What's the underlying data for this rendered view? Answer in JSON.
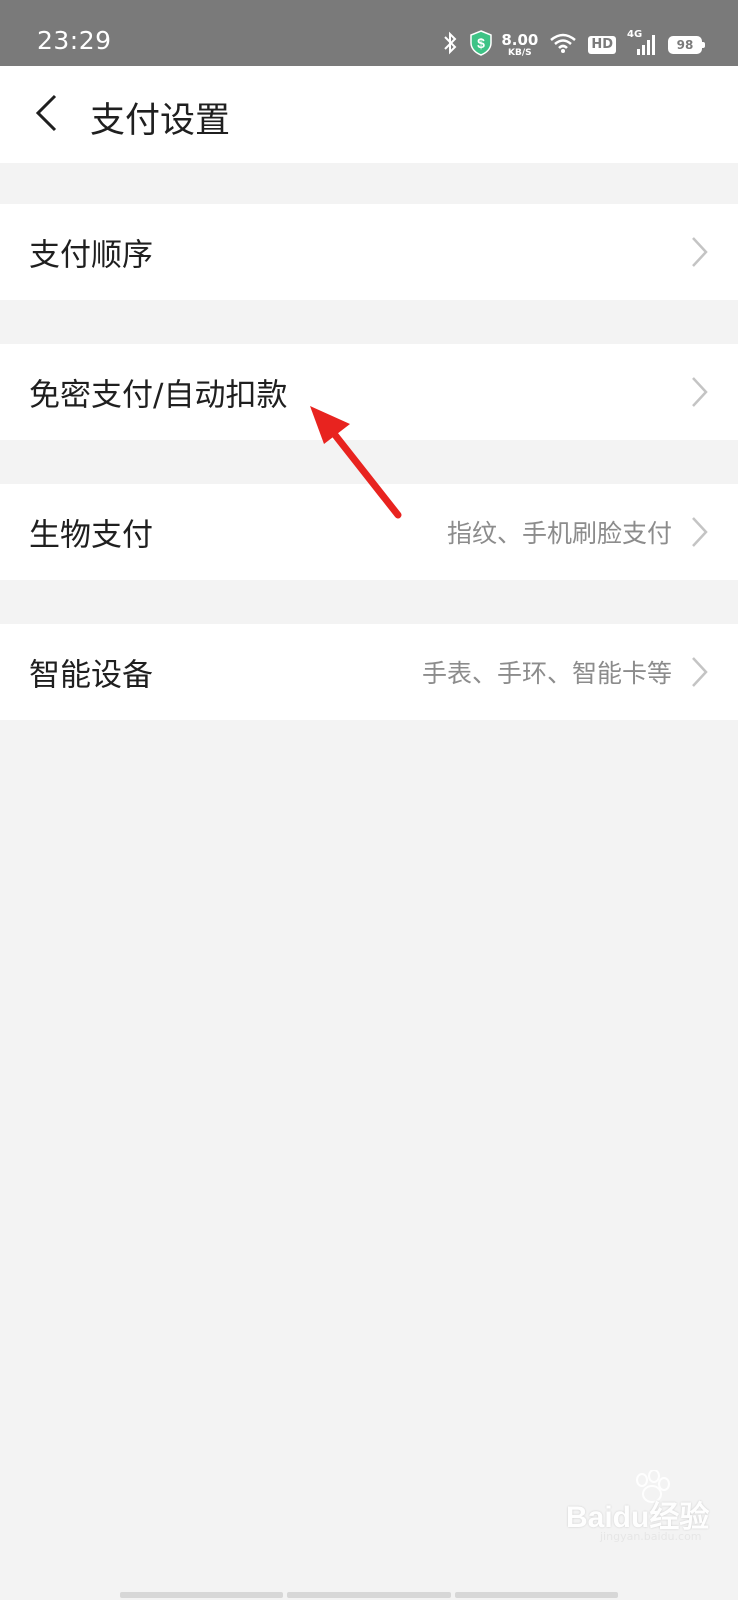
{
  "status_bar": {
    "time": "23:29",
    "network_speed_value": "8.00",
    "network_speed_unit": "KB/S",
    "hd_label": "HD",
    "signal_label": "4G",
    "battery_level": "98"
  },
  "nav": {
    "title": "支付设置"
  },
  "rows": [
    {
      "label": "支付顺序",
      "value": ""
    },
    {
      "label": "免密支付/自动扣款",
      "value": ""
    },
    {
      "label": "生物支付",
      "value": "指纹、手机刷脸支付"
    },
    {
      "label": "智能设备",
      "value": "手表、手环、智能卡等"
    }
  ],
  "watermark": {
    "logo": "Baidu经验",
    "sub": "jingyan.baidu.com"
  },
  "colors": {
    "status_bar_bg": "#7a7a7a",
    "page_bg": "#f3f3f3",
    "annotation_arrow": "#e8231f",
    "pay_shield": "#3ec386"
  }
}
